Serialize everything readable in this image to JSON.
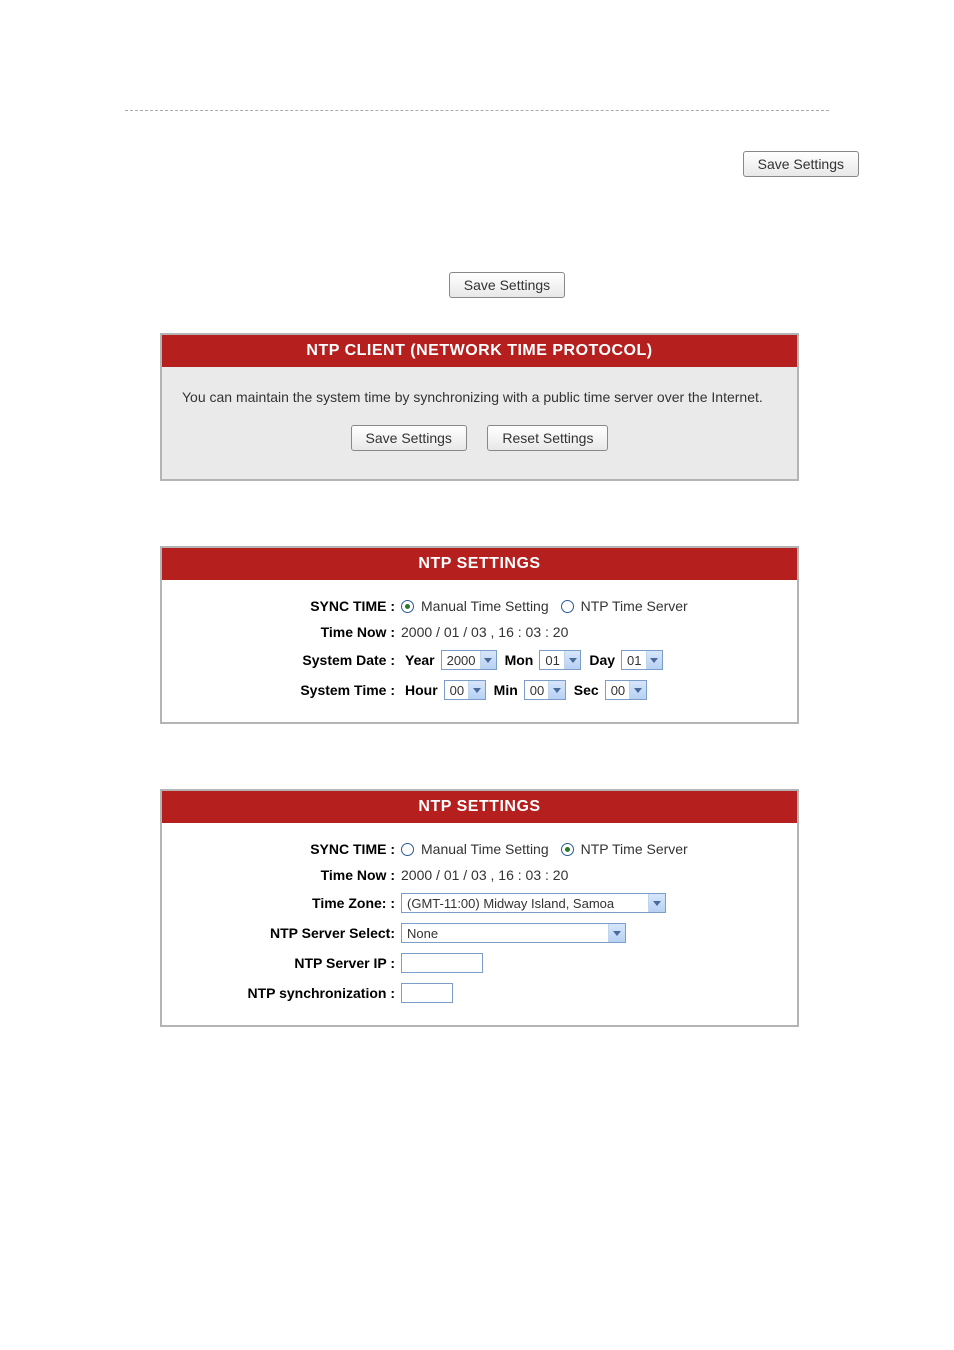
{
  "buttons": {
    "save": "Save Settings",
    "reset": "Reset Settings"
  },
  "ntp_client": {
    "header": "NTP CLIENT (NETWORK TIME PROTOCOL)",
    "description": "You can maintain the system time by synchronizing with a public time server over the Internet."
  },
  "ntp_settings1": {
    "header": "NTP SETTINGS",
    "sync_time_label": "SYNC TIME :",
    "manual_label": "Manual Time Setting",
    "ntp_server_label": "NTP Time Server",
    "time_now_label": "Time Now :",
    "time_now_value": "2000 / 01 / 03 , 16 : 03 : 20",
    "system_date_label": "System Date :",
    "year_label": "Year",
    "year_value": "2000",
    "mon_label": "Mon",
    "mon_value": "01",
    "day_label": "Day",
    "day_value": "01",
    "system_time_label": "System Time :",
    "hour_label": "Hour",
    "hour_value": "00",
    "min_label": "Min",
    "min_value": "00",
    "sec_label": "Sec",
    "sec_value": "00"
  },
  "ntp_settings2": {
    "header": "NTP SETTINGS",
    "sync_time_label": "SYNC TIME :",
    "manual_label": "Manual Time Setting",
    "ntp_server_label": "NTP Time Server",
    "time_now_label": "Time Now :",
    "time_now_value": "2000 / 01 / 03 , 16 : 03 : 20",
    "timezone_label": "Time Zone: :",
    "timezone_value": "(GMT-11:00) Midway Island, Samoa",
    "server_select_label": "NTP Server Select:",
    "server_select_value": "None",
    "server_ip_label": "NTP Server IP :",
    "server_ip_value": "",
    "sync_label": "NTP synchronization :",
    "sync_value": ""
  }
}
